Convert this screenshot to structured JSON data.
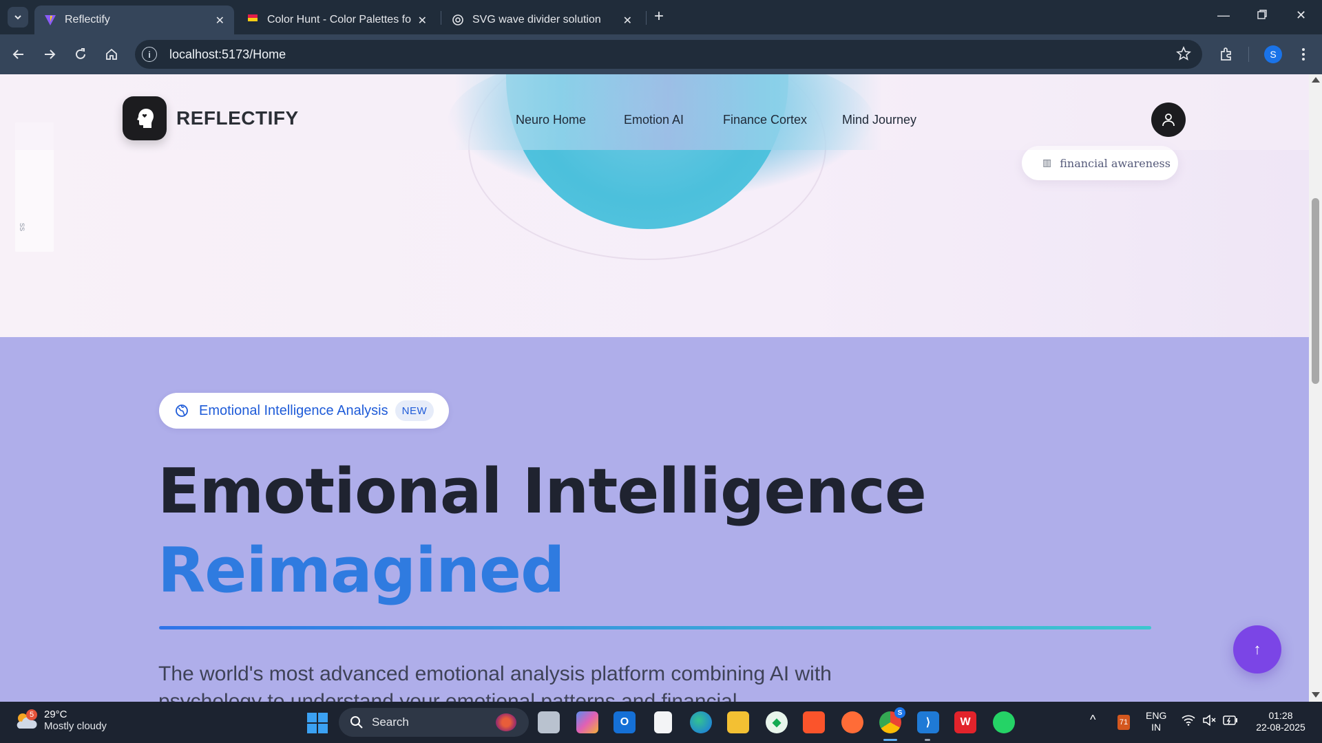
{
  "browser": {
    "tabs": [
      {
        "title": "Reflectify",
        "active": true
      },
      {
        "title": "Color Hunt - Color Palettes for D",
        "active": false
      },
      {
        "title": "SVG wave divider solution",
        "active": false
      }
    ],
    "url": "localhost:5173/Home",
    "profile_initial": "S"
  },
  "site": {
    "brand": "REFLECTIFY",
    "nav": [
      "Neuro Home",
      "Emotion AI",
      "Finance Cortex",
      "Mind Journey"
    ],
    "side_widget_text": "ss",
    "float_chip": "financial awareness"
  },
  "hero": {
    "pill_label": "Emotional Intelligence Analysis",
    "pill_badge": "NEW",
    "headline_line1": "Emotional Intelligence",
    "headline_line2": "Reimagined",
    "subtext": "The world's most advanced emotional analysis platform combining AI with psychology to understand your emotional patterns and financial",
    "scroll_top_icon": "↑"
  },
  "taskbar": {
    "weather_temp": "29°C",
    "weather_condition": "Mostly cloudy",
    "weather_badge": "5",
    "search_label": "Search",
    "lang_line1": "ENG",
    "lang_line2": "IN",
    "time": "01:28",
    "date": "22-08-2025",
    "chrome_badge": "S",
    "tray_badge": "71"
  },
  "colors": {
    "section_bg": "#afaeea",
    "headline_accent": "#2f7be0",
    "scroll_button": "#7b45e6"
  }
}
